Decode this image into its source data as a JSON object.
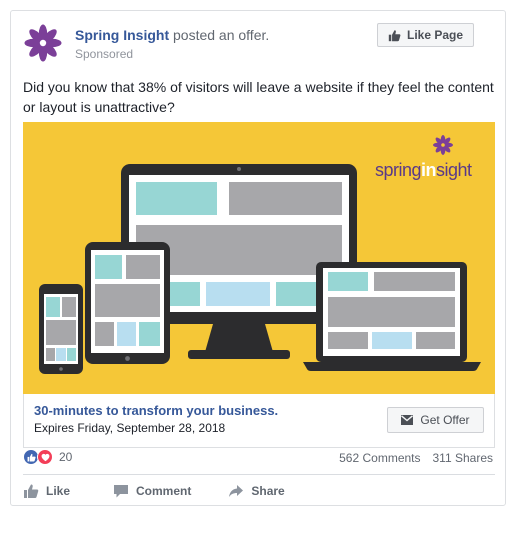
{
  "post": {
    "page_name": "Spring Insight",
    "action_text": "posted an offer.",
    "sponsored_label": "Sponsored",
    "like_page_label": "Like Page",
    "body_text": "Did you know that 38% of visitors will leave a website if they feel the content or layout is unattractive?"
  },
  "ad": {
    "brand_spring": "spring",
    "brand_in": "in",
    "brand_sight": "sight",
    "offer_title": "30-minutes to transform your business.",
    "offer_expiry": "Expires Friday, September 28, 2018",
    "get_offer_label": "Get Offer"
  },
  "stats": {
    "reaction_count": "20",
    "comments": "562 Comments",
    "shares": "311 Shares"
  },
  "actions": {
    "like": "Like",
    "comment": "Comment",
    "share": "Share"
  },
  "colors": {
    "brand_blue": "#365899",
    "ad_background": "#f5c737",
    "flower_purple": "#7b3f98",
    "accent_teal": "#97d6d4",
    "accent_blue": "#b8def0",
    "device_dark": "#2c2c2e",
    "like_blue": "#4267b2",
    "love_red": "#f33e58"
  },
  "icons": {
    "avatar": "purple-flower-icon",
    "like_page": "thumbs-up-icon",
    "get_offer": "envelope-icon",
    "like_action": "thumbs-up-icon",
    "comment_action": "comment-bubble-icon",
    "share_action": "share-arrow-icon"
  }
}
